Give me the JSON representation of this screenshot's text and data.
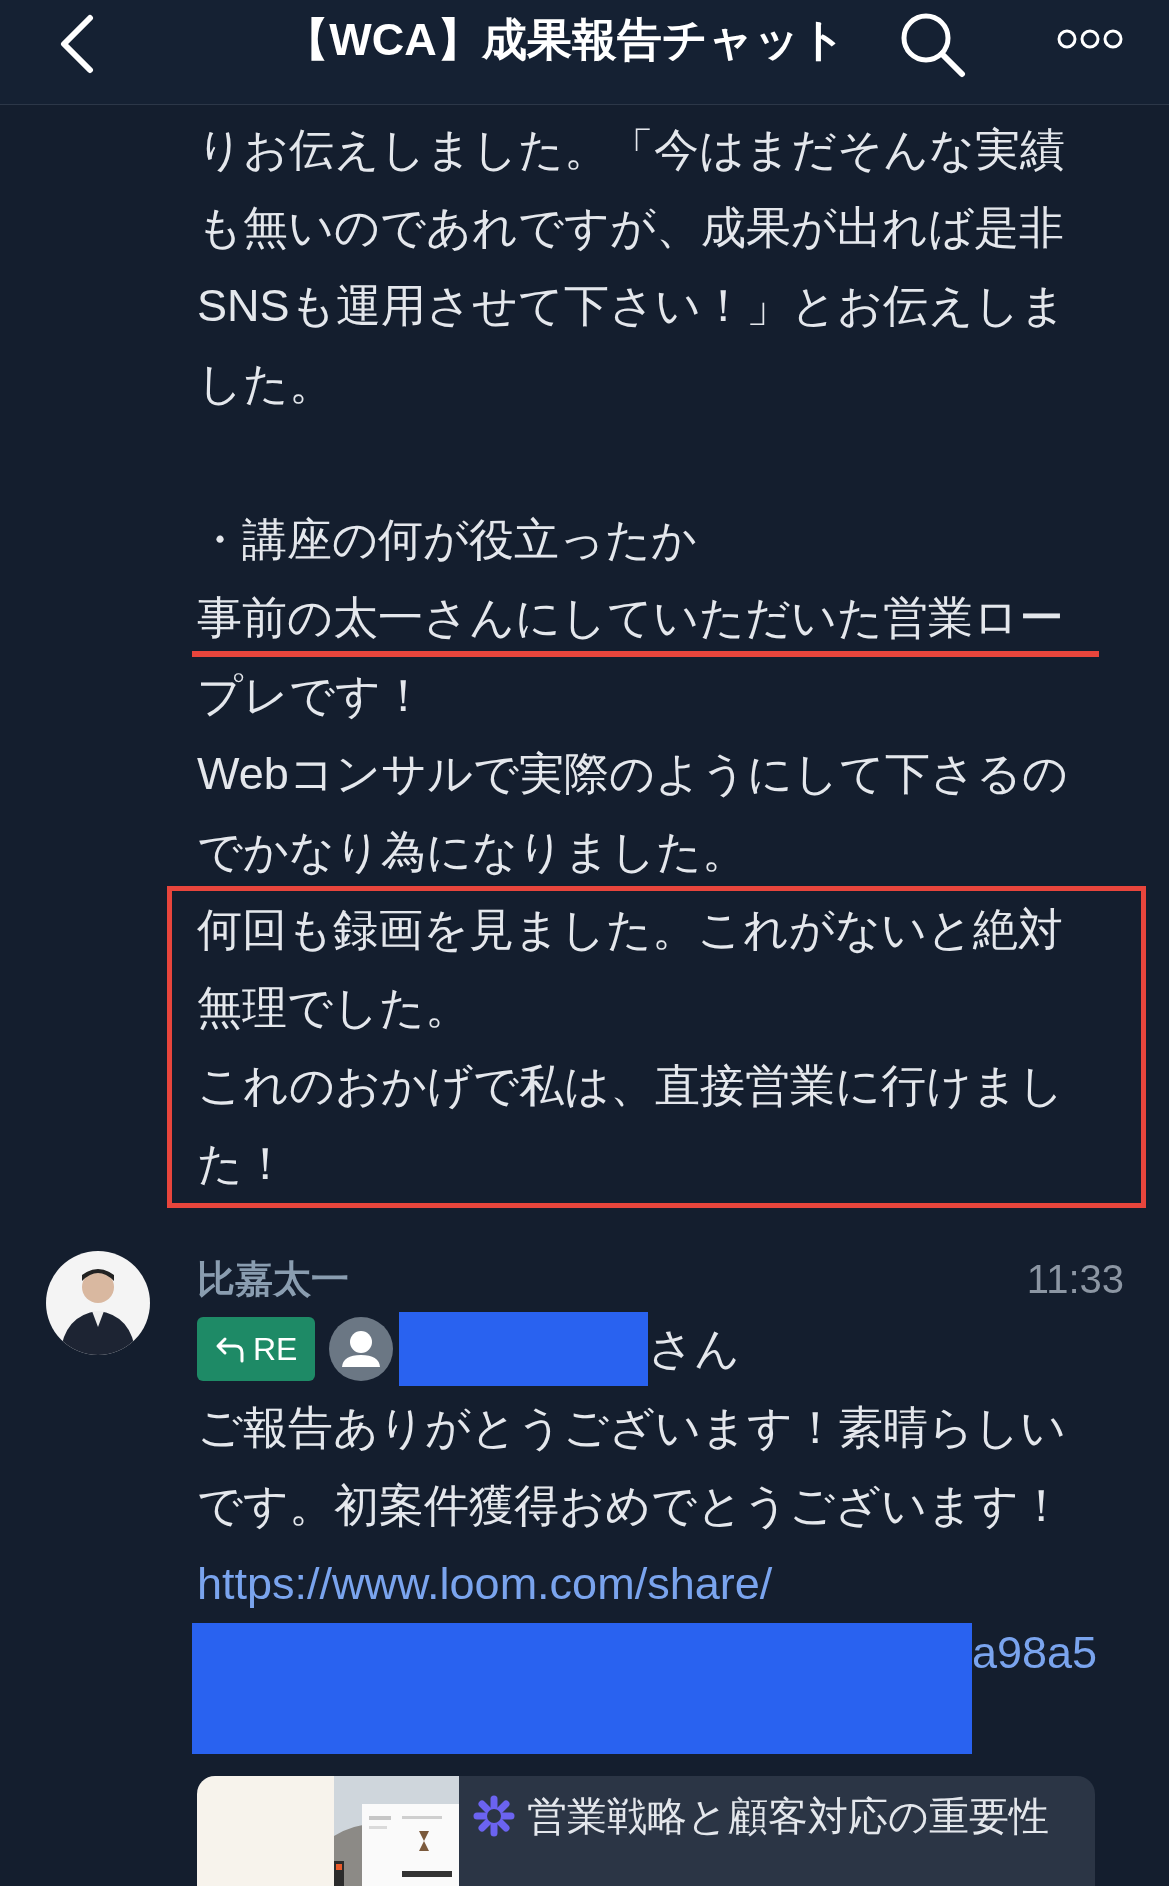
{
  "header": {
    "title": "【WCA】成果報告チャット"
  },
  "message_1": {
    "blocks": [
      {
        "blank_line_before": false,
        "framed": false,
        "lines": [
          {
            "text": "りお伝えしました。「今はまだそんな実績",
            "underlined": false
          },
          {
            "text": "も無いのであれですが、成果が出れば是非",
            "underlined": false
          },
          {
            "text": "SNSも運用させて下さい！」とお伝えしま",
            "underlined": false
          },
          {
            "text": "した。",
            "underlined": false
          }
        ]
      },
      {
        "blank_line_before": true,
        "framed": false,
        "lines": [
          {
            "text": "・講座の何が役立ったか",
            "underlined": false
          },
          {
            "text": "事前の太一さんにしていただいた営業ロー",
            "underlined": true
          },
          {
            "text": "プレです！",
            "underlined": false
          },
          {
            "text": "Webコンサルで実際のようにして下さるの",
            "underlined": false
          },
          {
            "text": "でかなり為になりました。",
            "underlined": false
          }
        ]
      },
      {
        "blank_line_before": false,
        "framed": true,
        "lines": [
          {
            "text": "何回も録画を見ました。これがないと絶対",
            "underlined": false
          },
          {
            "text": "無理でした。",
            "underlined": false
          },
          {
            "text": "これのおかげで私は、直接営業に行けまし",
            "underlined": false
          },
          {
            "text": "た！",
            "underlined": false
          }
        ]
      }
    ]
  },
  "message_2": {
    "sender": "比嘉太一",
    "time": "11:33",
    "reply_badge": "RE",
    "mention_suffix": "さん",
    "lines": [
      "ご報告ありがとうございます！素晴らしい",
      "です。初案件獲得おめでとうございます！"
    ],
    "link_lines": [
      "https://www.loom.com/share/",
      "a98a5"
    ],
    "preview": {
      "title": "営業戦略と顧客対応の重要性"
    }
  }
}
